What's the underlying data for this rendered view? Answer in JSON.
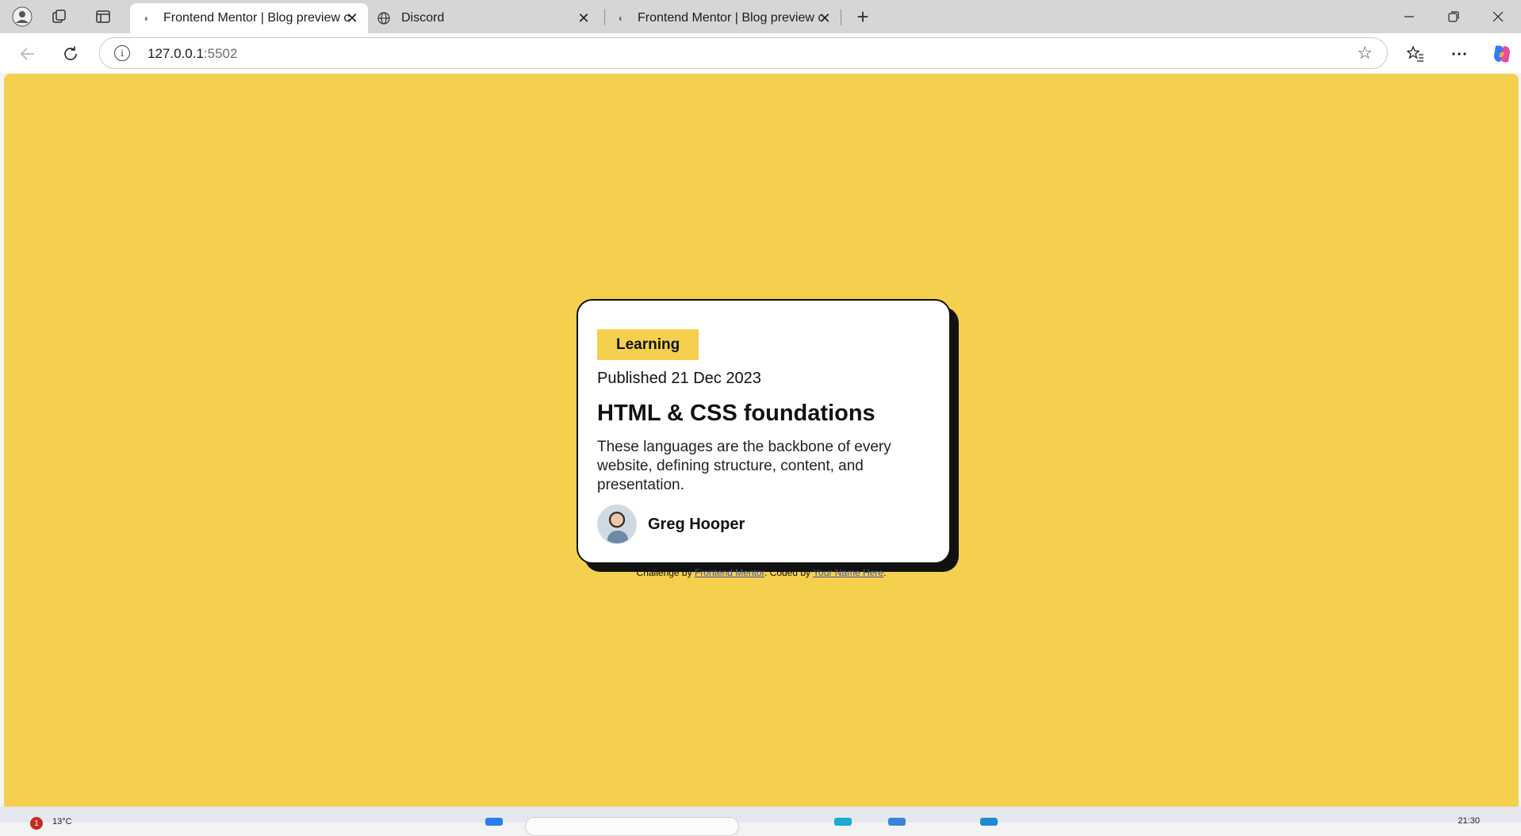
{
  "browser": {
    "tabs": [
      {
        "title": "Frontend Mentor | Blog preview c",
        "active": true
      },
      {
        "title": "Discord",
        "active": false
      },
      {
        "title": "Frontend Mentor | Blog preview c",
        "active": false
      }
    ],
    "new_tab_symbol": "+",
    "address": {
      "host": "127.0.0.1",
      "port": ":5502"
    }
  },
  "card": {
    "tag": "Learning",
    "published": "Published 21 Dec 2023",
    "title": "HTML & CSS foundations",
    "description": "These languages are the backbone of every website, defining structure, content, and presentation.",
    "author": "Greg Hooper"
  },
  "attribution": {
    "prefix": "Challenge by ",
    "link1": "Frontend Mentor",
    "middle": ". Coded by ",
    "link2": "Your Name Here",
    "suffix": "."
  },
  "taskbar": {
    "weather_badge": "1",
    "temperature": "13°C",
    "time": "21:30"
  },
  "colors": {
    "page_background": "#f4d04e",
    "card_background": "#ffffff",
    "tag_background": "#f4d04e",
    "card_shadow": "#111111"
  }
}
